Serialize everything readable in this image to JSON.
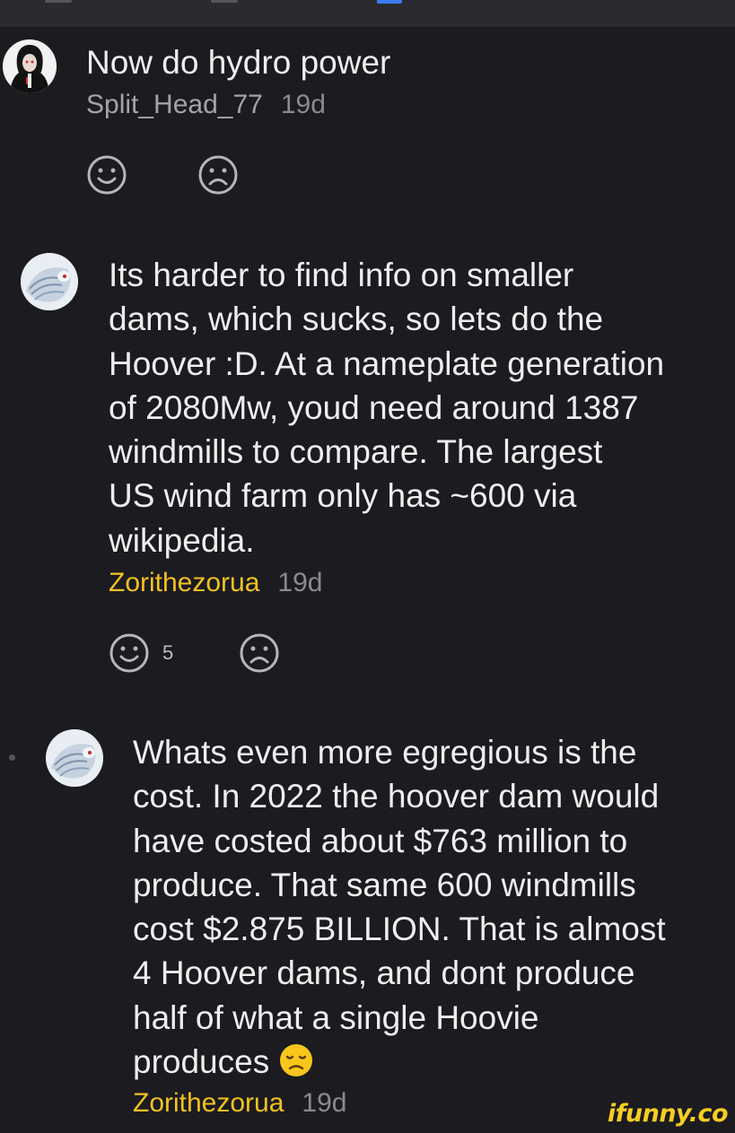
{
  "comments": [
    {
      "text_lines": [
        "Now do hydro power"
      ],
      "author": "Split_Head_77",
      "time": "19d",
      "reactions": {
        "smile_count": "",
        "frown_count": ""
      }
    },
    {
      "text_lines": [
        "Its harder to find info on smaller",
        "dams, which sucks, so lets do the",
        "Hoover :D. At a nameplate generation",
        "of 2080Mw, youd need around 1387",
        "windmills to compare. The largest",
        "US wind farm only has ~600 via",
        "wikipedia."
      ],
      "author": "Zorithezorua",
      "time": "19d",
      "reactions": {
        "smile_count": "5",
        "frown_count": ""
      }
    },
    {
      "text_lines": [
        "Whats even more egregious is the",
        "cost. In 2022 the hoover dam would",
        "have costed about $763 million to",
        "produce. That same 600 windmills",
        "cost $2.875 BILLION. That is almost",
        "4 Hoover dams, and dont produce",
        "half of what a single Hoovie",
        "produces"
      ],
      "author": "Zorithezorua",
      "time": "19d",
      "trailing_emoji": "disappointed-face-emoji"
    }
  ],
  "icons": {
    "smile": "smile-face-icon",
    "frown": "frown-face-icon"
  },
  "colors": {
    "background": "#1b1b20",
    "author_highlight": "#f2c21f",
    "author_default": "#a3a3a8",
    "timestamp": "#8a8a90",
    "text": "#eeeeee"
  },
  "watermark": "ifunny.co"
}
